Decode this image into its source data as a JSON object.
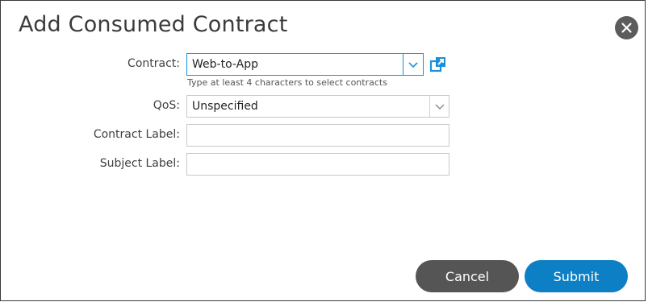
{
  "dialog": {
    "title": "Add Consumed Contract",
    "close_icon": "close-icon"
  },
  "form": {
    "contract": {
      "label": "Contract:",
      "value": "Web-to-App",
      "hint": "Type at least 4 characters to select contracts",
      "dropdown_icon": "chevron-down-icon",
      "open_icon": "external-link-icon"
    },
    "qos": {
      "label": "QoS:",
      "value": "Unspecified",
      "dropdown_icon": "chevron-down-icon"
    },
    "contract_label": {
      "label": "Contract Label:",
      "value": ""
    },
    "subject_label": {
      "label": "Subject Label:",
      "value": ""
    }
  },
  "buttons": {
    "cancel": "Cancel",
    "submit": "Submit"
  },
  "colors": {
    "accent": "#0d7fc4",
    "cancel": "#555555",
    "focus_border": "#1b8fd9"
  }
}
